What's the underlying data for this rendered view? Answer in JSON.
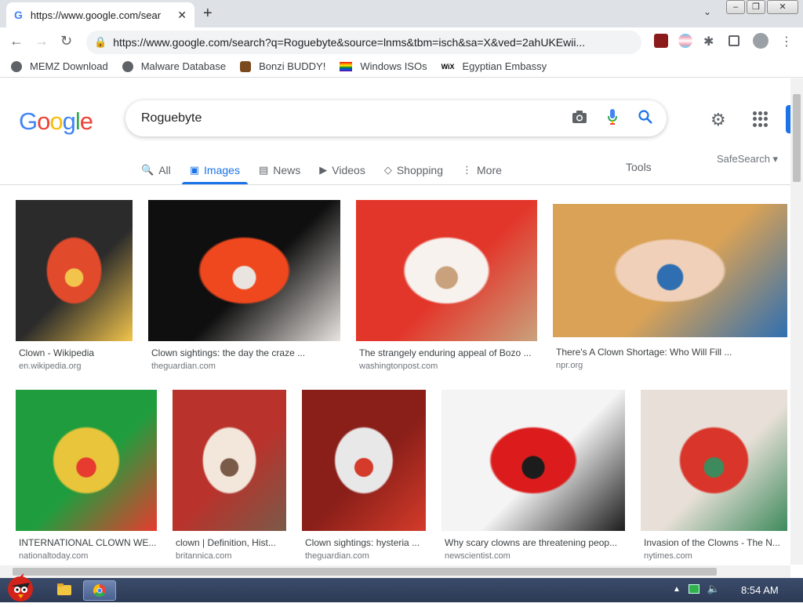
{
  "browser": {
    "tab_title": "https://www.google.com/sear",
    "tab_favicon": "G",
    "url": "https://www.google.com/search?q=Roguebyte&source=lnms&tbm=isch&sa=X&ved=2ahUKEwii..."
  },
  "bookmarks": [
    {
      "label": "MEMZ Download",
      "icon": "globe-icon"
    },
    {
      "label": "Malware Database",
      "icon": "globe-icon"
    },
    {
      "label": "Bonzi BUDDY!",
      "icon": "bonzi-icon"
    },
    {
      "label": "Windows ISOs",
      "icon": "rainbow-flag-icon"
    },
    {
      "label": "Egyptian Embassy",
      "icon": "wix-icon"
    }
  ],
  "google": {
    "logo": "Google",
    "query": "Roguebyte",
    "tabs": [
      {
        "label": "All",
        "icon": "🔍"
      },
      {
        "label": "Images",
        "icon": "▣"
      },
      {
        "label": "News",
        "icon": "▤"
      },
      {
        "label": "Videos",
        "icon": "▶"
      },
      {
        "label": "Shopping",
        "icon": "◇"
      },
      {
        "label": "More",
        "icon": "⋮"
      }
    ],
    "tools_label": "Tools",
    "safesearch_label": "SafeSearch ▾",
    "results_row1": [
      {
        "caption": "Clown - Wikipedia",
        "source": "en.wikipedia.org",
        "colors": [
          "#2b2b2b",
          "#e24a2c",
          "#f2c44b"
        ]
      },
      {
        "caption": "Clown sightings: the day the craze ...",
        "source": "theguardian.com",
        "colors": [
          "#0f0f0f",
          "#f0481e",
          "#e9e4e0"
        ]
      },
      {
        "caption": "The strangely enduring appeal of Bozo ...",
        "source": "washingtonpost.com",
        "colors": [
          "#e3362a",
          "#f7f2ee",
          "#c9a27d"
        ]
      },
      {
        "caption": "There's A Clown Shortage: Who Will Fill ...",
        "source": "npr.org",
        "colors": [
          "#d9a256",
          "#f0d0b8",
          "#2f6fb1"
        ]
      }
    ],
    "results_row2": [
      {
        "caption": "INTERNATIONAL CLOWN WE...",
        "source": "nationaltoday.com",
        "colors": [
          "#1f9d3e",
          "#e8c53a",
          "#e63b2e"
        ]
      },
      {
        "caption": "clown | Definition, Hist...",
        "source": "britannica.com",
        "colors": [
          "#b9322b",
          "#f3e6da",
          "#7a5a48"
        ]
      },
      {
        "caption": "Clown sightings: hysteria ...",
        "source": "theguardian.com",
        "colors": [
          "#8a1f19",
          "#e8e8e8",
          "#d43b2a"
        ]
      },
      {
        "caption": "Why scary clowns are threatening peop...",
        "source": "newscientist.com",
        "colors": [
          "#f4f4f4",
          "#dc1c1c",
          "#1c1c1c"
        ]
      },
      {
        "caption": "Invasion of the Clowns - The N...",
        "source": "nytimes.com",
        "colors": [
          "#e8e0d8",
          "#d9352a",
          "#3e8a5c"
        ]
      }
    ]
  },
  "taskbar": {
    "clock": "8:54 AM"
  }
}
